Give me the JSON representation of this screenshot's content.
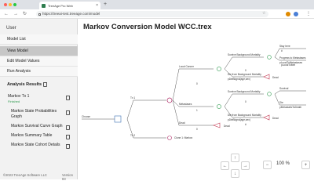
{
  "browser": {
    "tab_title": "TreeAge Pro Web",
    "url": "https://treeai-test.treeage.com/model",
    "colors": {
      "close": "#ff5f57",
      "minimize": "#febc2e",
      "maximize": "#28c840",
      "ext1": "#e08a00",
      "ext2": "#4a7fd6"
    },
    "icons": {
      "back": "←",
      "forward": "→",
      "reload": "↻",
      "star": "☆",
      "close": "×",
      "new_tab": "+",
      "menu": "⋮"
    }
  },
  "sidebar": {
    "heading": "User",
    "items": [
      {
        "label": "Model List",
        "active": false
      },
      {
        "label": "View Model",
        "active": true
      },
      {
        "label": "Edit Model Values",
        "active": false
      },
      {
        "label": "Run Analysis",
        "active": false
      }
    ],
    "analysis_heading": "Analysis Results",
    "results": [
      {
        "label": "Markov Tx 1",
        "status": "Finished"
      },
      {
        "label": "Markov State Probabilities Graph"
      },
      {
        "label": "Markov Survival Curve Graph"
      },
      {
        "label": "Markov Summary Table"
      },
      {
        "label": "Markov State Cohort Details"
      }
    ],
    "footer": {
      "copyright": "©2023 TreeAge Software LLC",
      "version": "Version 83"
    }
  },
  "main": {
    "title": "Markov Conversion Model WCC.trex",
    "tree": {
      "root": "Choose",
      "tx1": "Tx 1",
      "tx2": "Tx 2",
      "clone": "Clone 1: Markov",
      "states": [
        "Local Cancer",
        "Metastases",
        "Dead"
      ],
      "local_branches": [
        "Survive Background Mortality",
        "Die from Background Mortality"
      ],
      "local_sub": [
        "Stay here",
        "Progress to Metastases",
        "pLocalToMetastases",
        "#",
        "pLocalToMet"
      ],
      "meta_branches": [
        "Survive Background Mortality",
        "Die from Background Mortality"
      ],
      "meta_sub": [
        "Survival",
        "Die",
        "pMetastaticToDeath"
      ],
      "terminals": [
        "Dead",
        "Dead",
        "Dead"
      ],
      "markers": [
        "pDieBkgnd(age,sex)",
        "pDieBkgnd(age,sex)"
      ],
      "nums": [
        "0",
        "1",
        "0",
        "0",
        "0",
        "#"
      ]
    },
    "controls": {
      "up": "↑",
      "down": "↓",
      "left": "←",
      "right": "→",
      "zoom_out": "−",
      "zoom_in": "+",
      "zoom": "100 %"
    }
  },
  "colors": {
    "accent": "#3d6fb4",
    "markov": "#b0306a",
    "chance": "#2e9a4e",
    "terminal": "#c0304a",
    "status": "#2e9a4e"
  }
}
